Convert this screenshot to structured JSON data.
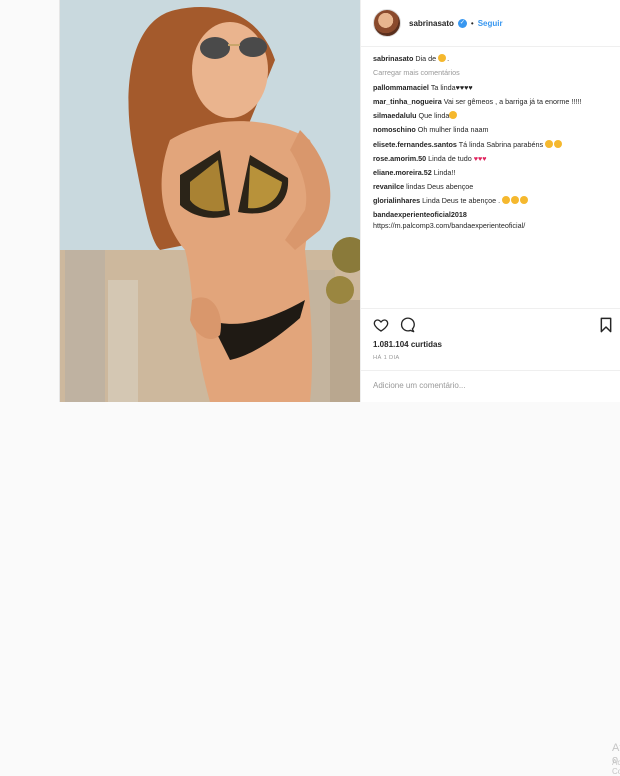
{
  "header": {
    "username": "sabrinasato",
    "separator": "•",
    "follow_label": "Seguir"
  },
  "caption": {
    "username": "sabrinasato",
    "text": "Dia de"
  },
  "load_more": "Carregar mais comentários",
  "comments": [
    {
      "user": "pallommamaciel",
      "text": "Ta linda♥♥♥♥"
    },
    {
      "user": "mar_tinha_nogueira",
      "text": "Vai ser gêmeos , a barriga já ta enorme !!!!!"
    },
    {
      "user": "silmaedalulu",
      "text": "Que linda"
    },
    {
      "user": "nomoschino",
      "text": "Oh mulher linda naam"
    },
    {
      "user": "elisete.fernandes.santos",
      "text": "Tá linda Sabrina parabéns"
    },
    {
      "user": "rose.amorim.50",
      "text": "Linda de tudo"
    },
    {
      "user": "eliane.moreira.52",
      "text": "Linda!!"
    },
    {
      "user": "revanilce",
      "text": "lindas Deus abençoe"
    },
    {
      "user": "glorialinhares",
      "text": "Linda Deus te abençoe ."
    },
    {
      "user": "bandaexperienteoficial2018",
      "text": "https://m.palcomp3.com/bandaexperienteoficial/"
    }
  ],
  "likes": "1.081.104 curtidas",
  "timestamp": "HÁ 1 DIA",
  "add_comment": {
    "placeholder": "Adicione um comentário..."
  },
  "watermark": {
    "line1": "Ativar o W",
    "line2": "Acesse Config"
  },
  "icons": {
    "like": "heart-icon",
    "comment": "comment-icon",
    "save": "bookmark-icon",
    "verified": "verified-badge-icon"
  },
  "colors": {
    "link": "#3897f0",
    "muted": "#999999",
    "text": "#262626"
  }
}
